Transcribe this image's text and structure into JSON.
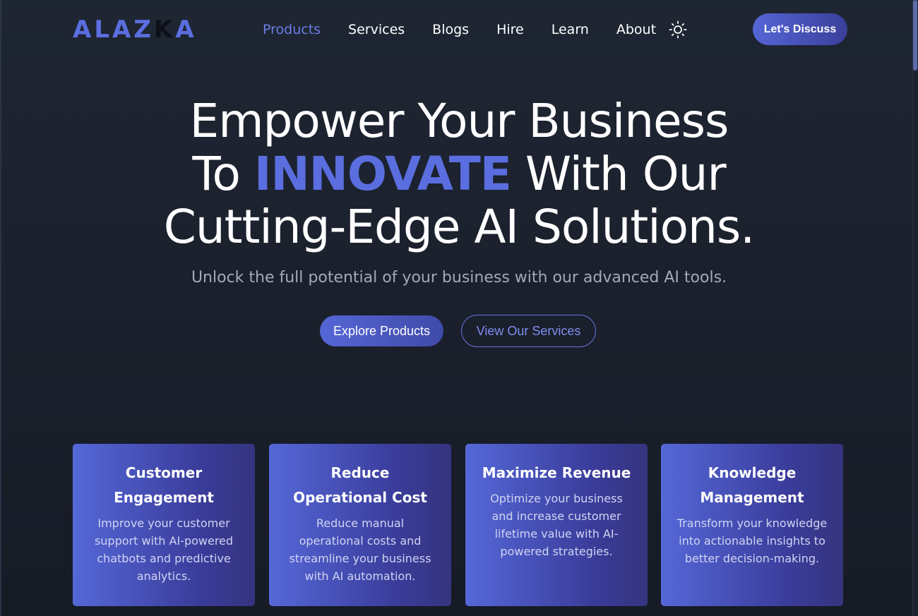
{
  "nav": {
    "logo": "ALAZKA",
    "logo_parts": [
      "ALAZ",
      "K",
      "A"
    ],
    "links": [
      {
        "label": "Products",
        "active": true
      },
      {
        "label": "Services",
        "active": false
      },
      {
        "label": "Blogs",
        "active": false
      },
      {
        "label": "Hire",
        "active": false
      },
      {
        "label": "Learn",
        "active": false
      },
      {
        "label": "About",
        "active": false
      }
    ],
    "theme_toggle_icon": "sun-icon",
    "cta_label": "Let's Discuss"
  },
  "hero": {
    "title_line1": "Empower Your Business",
    "title_line2_prefix": "To ",
    "title_accent": "INNOVATE",
    "title_line2_suffix": " With Our",
    "title_line3": "Cutting-Edge AI Solutions.",
    "subtitle": "Unlock the full potential of your business with our advanced AI tools.",
    "primary_button": "Explore Products",
    "secondary_button": "View Our Services"
  },
  "cards": [
    {
      "title": "Customer Engagement",
      "description": "Improve your customer support with AI-powered chatbots and predictive analytics."
    },
    {
      "title": "Reduce Operational Cost",
      "description": "Reduce manual operational costs and streamline your business with AI automation."
    },
    {
      "title": "Maximize Revenue",
      "description": "Optimize your business and increase customer lifetime value with AI-powered strategies."
    },
    {
      "title": "Knowledge Management",
      "description": "Transform your knowledge into actionable insights to better decision-making."
    }
  ],
  "colors": {
    "accent": "#5a6ee0",
    "background": "#1c2230",
    "card_gradient_start": "#5568d8",
    "card_gradient_end": "#35347f"
  }
}
